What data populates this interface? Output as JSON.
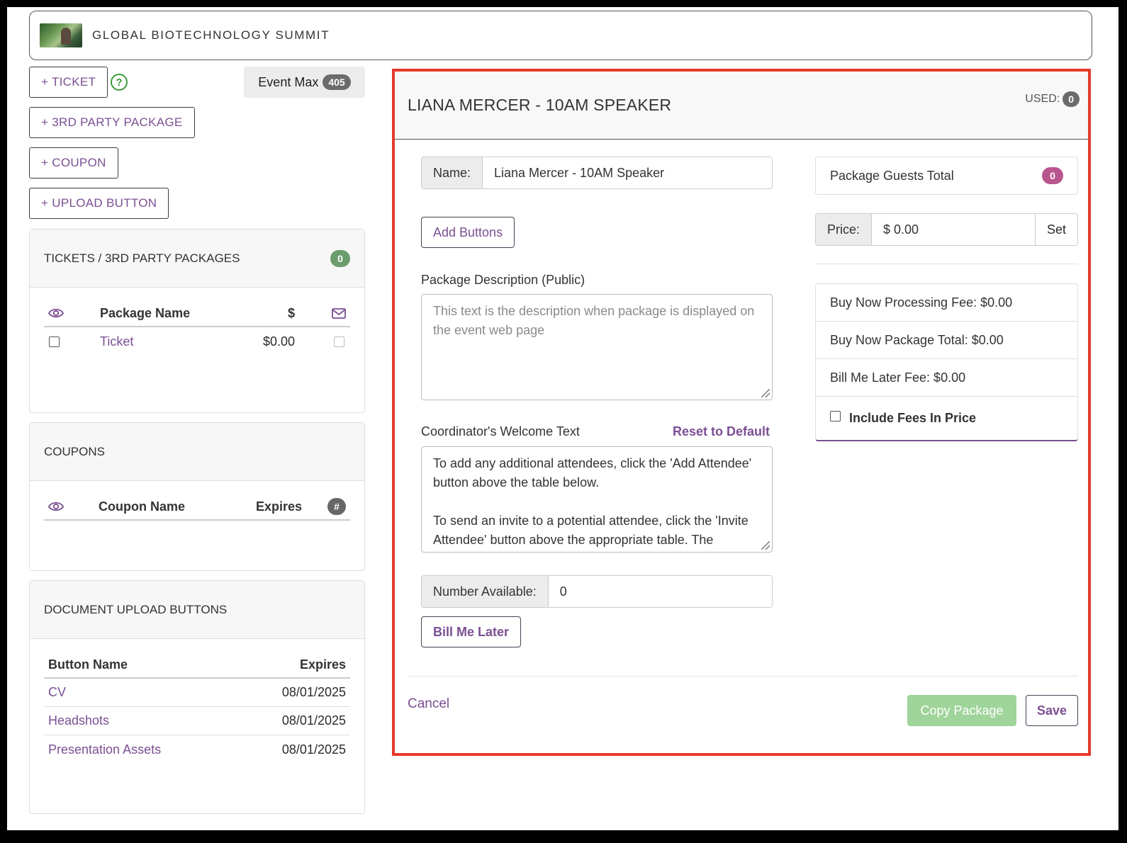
{
  "header": {
    "title": "GLOBAL BIOTECHNOLOGY SUMMIT"
  },
  "toolbar": {
    "add_ticket": "+ TICKET",
    "help": "?",
    "add_3rd_party": "+ 3RD PARTY PACKAGE",
    "add_coupon": "+ COUPON",
    "add_upload": "+ UPLOAD BUTTON",
    "event_max_label": "Event Max",
    "event_max_value": "405"
  },
  "tickets_panel": {
    "title": "TICKETS / 3RD PARTY PACKAGES",
    "count": "0",
    "columns": {
      "name": "Package Name",
      "price": "$"
    },
    "rows": [
      {
        "name": "Ticket",
        "price": "$0.00"
      }
    ]
  },
  "coupons_panel": {
    "title": "COUPONS",
    "columns": {
      "name": "Coupon Name",
      "expires": "Expires",
      "count": "#"
    }
  },
  "uploads_panel": {
    "title": "DOCUMENT UPLOAD BUTTONS",
    "columns": {
      "name": "Button Name",
      "expires": "Expires"
    },
    "rows": [
      {
        "name": "CV",
        "expires": "08/01/2025"
      },
      {
        "name": "Headshots",
        "expires": "08/01/2025"
      },
      {
        "name": "Presentation Assets",
        "expires": "08/01/2025"
      }
    ]
  },
  "editor": {
    "title": "LIANA MERCER - 10AM SPEAKER",
    "used_label": "USED:",
    "used_value": "0",
    "name_label": "Name:",
    "name_value": "Liana Mercer - 10AM Speaker",
    "add_buttons": "Add Buttons",
    "description_label": "Package Description (Public)",
    "description_placeholder": "This text is the description when package is displayed on the event web page",
    "welcome_label": "Coordinator's Welcome Text",
    "reset_label": "Reset to Default",
    "welcome_line1": "To add any additional attendees, click the 'Add Attendee' button above the  table below.",
    "welcome_line2": "To send an invite to a potential attendee, click the 'Invite Attendee' button above the appropriate table. The individual will receive an invite email from",
    "number_available_label": "Number Available:",
    "number_available_value": "0",
    "bill_me_later": "Bill Me Later",
    "guests_total_label": "Package Guests Total",
    "guests_total_value": "0",
    "price_label": "Price:",
    "price_value": "$ 0.00",
    "set_label": "Set",
    "fees": {
      "processing": "Buy Now Processing Fee: $0.00",
      "package_total": "Buy Now Package Total: $0.00",
      "bill_later_fee": "Bill Me Later Fee: $0.00",
      "include_fees": "Include Fees In Price"
    },
    "cancel": "Cancel",
    "copy_package": "Copy Package",
    "save": "Save"
  },
  "colors": {
    "accent": "#7b4f92",
    "highlight_border": "#e53a2b",
    "green_badge": "#6b9c6b",
    "pink_badge": "#b9558e",
    "copy_button": "#9fd49a"
  }
}
